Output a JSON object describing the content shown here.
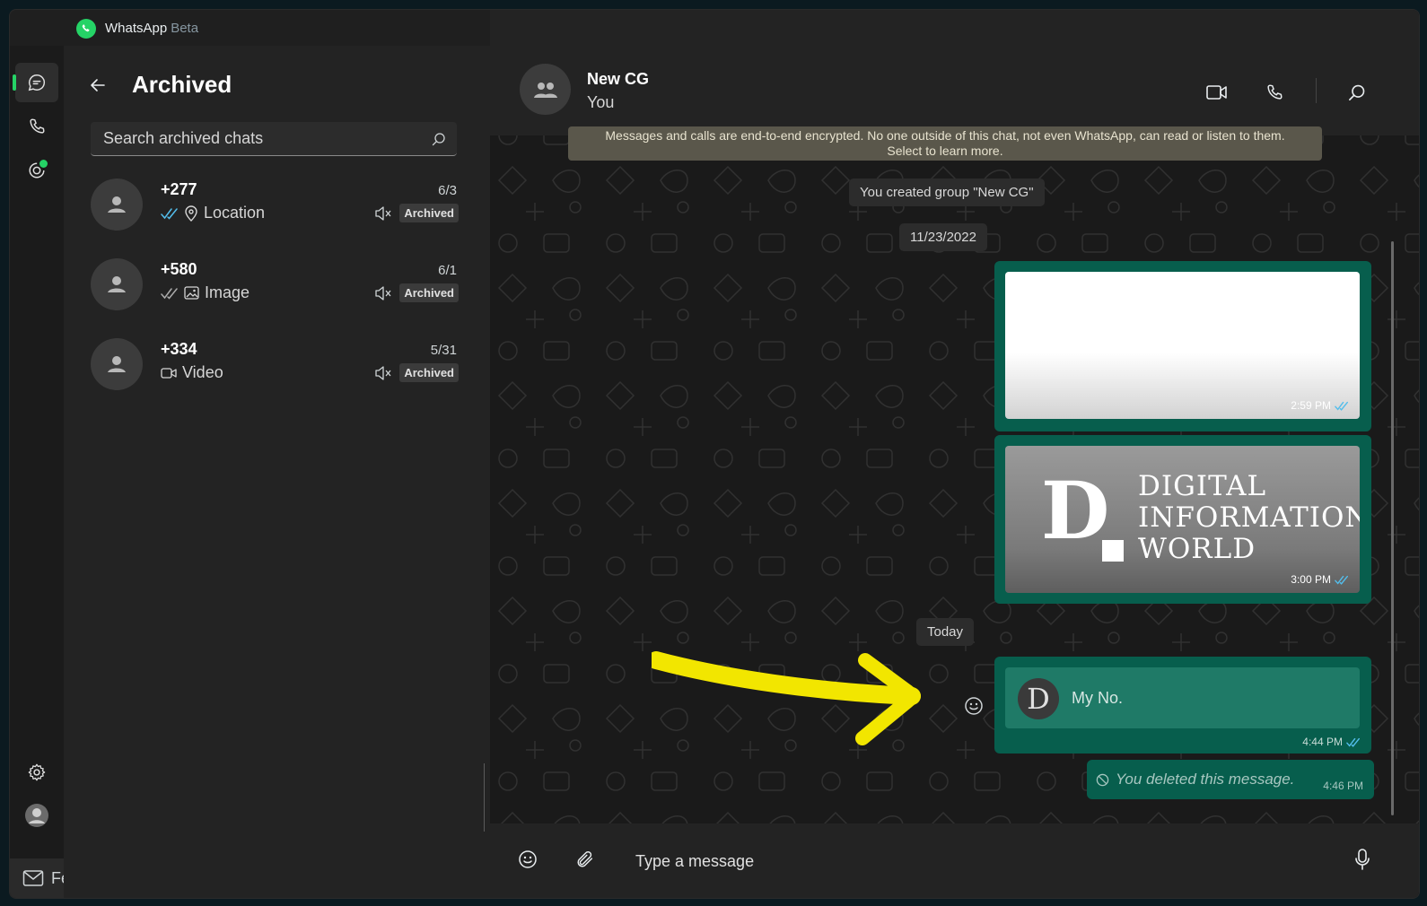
{
  "titlebar": {
    "app_name": "WhatsApp",
    "app_tag": "Beta"
  },
  "rail": {
    "feedback_label": "Feedback"
  },
  "panel": {
    "title": "Archived",
    "search_placeholder": "Search archived chats",
    "chats": [
      {
        "name": "+277",
        "date": "6/3",
        "preview_icon": "location-pin-icon",
        "preview": "Location",
        "ticks": "blue",
        "badge": "Archived"
      },
      {
        "name": "+580",
        "date": "6/1",
        "preview_icon": "image-icon",
        "preview": "Image",
        "ticks": "grey",
        "badge": "Archived"
      },
      {
        "name": "+334",
        "date": "5/31",
        "preview_icon": "video-icon",
        "preview": "Video",
        "ticks": "none",
        "badge": "Archived"
      }
    ]
  },
  "conversation": {
    "name": "New CG",
    "subtitle": "You",
    "encryption_line1": "Messages and calls are end-to-end encrypted. No one outside of this chat, not even WhatsApp, can read or listen to them.",
    "encryption_line2": "Select to learn more.",
    "system_created": "You created group \"New CG\"",
    "date_1": "11/23/2022",
    "date_2": "Today",
    "messages": [
      {
        "type": "image",
        "time": "2:59 PM"
      },
      {
        "type": "image",
        "time": "3:00 PM",
        "logo_letter": "D",
        "logo_lines": [
          "DIGITAL",
          "INFORMATION",
          "WORLD"
        ]
      },
      {
        "type": "contact",
        "contact_initial": "D",
        "contact_name": "My No.",
        "time": "4:44 PM"
      },
      {
        "type": "deleted",
        "text": "You deleted this message.",
        "time": "4:46 PM"
      }
    ],
    "composer_placeholder": "Type a message"
  },
  "colors": {
    "accent": "#25d366",
    "outgoing_bubble": "#075e4d",
    "read_tick": "#53bdeb",
    "annotation_arrow": "#f2e600"
  }
}
